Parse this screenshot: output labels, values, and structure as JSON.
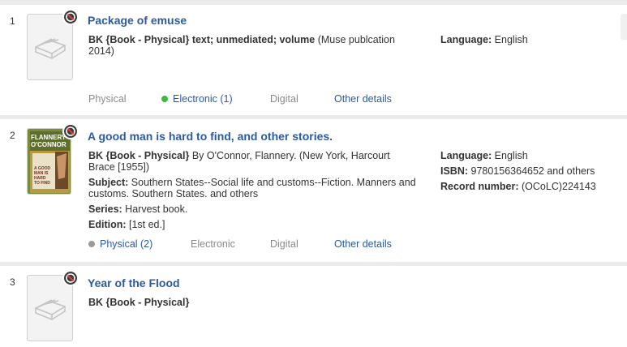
{
  "results": [
    {
      "number": "1",
      "title": "Package of emuse",
      "cover": "generic-book-icon",
      "format_bold": "BK {Book - Physical} text; unmediated; volume",
      "format_rest": " (Muse publcation 2014)",
      "language_label": "Language:",
      "language_value": " English",
      "tabs": {
        "physical": "Physical",
        "electronic": "Electronic (1)",
        "digital": "Digital",
        "other": "Other details"
      }
    },
    {
      "number": "2",
      "title": "A good man is hard to find, and other stories.",
      "cover": "book-cover-image",
      "cover_text": {
        "author_top": "FLANNERY",
        "author_bottom": "O'CONNOR",
        "title_lines": [
          "A GOOD",
          "MAN IS",
          "HARD",
          "TO FIND"
        ]
      },
      "format_bold": "BK {Book - Physical}",
      "format_rest": " By O'Connor, Flannery. (New York, Harcourt Brace [1955])",
      "subject_label": "Subject:",
      "subject_value": " Southern States--Social life and customs--Fiction. Manners and customs. Southern States. and others",
      "series_label": "Series:",
      "series_value": " Harvest book.",
      "edition_label": "Edition:",
      "edition_value": " [1st ed.]",
      "language_label": "Language:",
      "language_value": " English",
      "isbn_label": "ISBN:",
      "isbn_value": " 9780156364652 and others",
      "record_label": "Record number:",
      "record_value": " (OCoLC)224143",
      "tabs": {
        "physical": "Physical (2)",
        "electronic": "Electronic",
        "digital": "Digital",
        "other": "Other details"
      }
    },
    {
      "number": "3",
      "title": "Year of the Flood",
      "cover": "generic-book-icon",
      "format_bold": "BK {Book - Physical}"
    }
  ],
  "colors": {
    "link": "#2c5aa0",
    "available": "#3dbb3d",
    "unavailable": "#9a9a9a",
    "muted": "#8a8a8a"
  },
  "icons": {
    "badge": "no-entry-icon",
    "placeholder": "open-book-icon"
  }
}
